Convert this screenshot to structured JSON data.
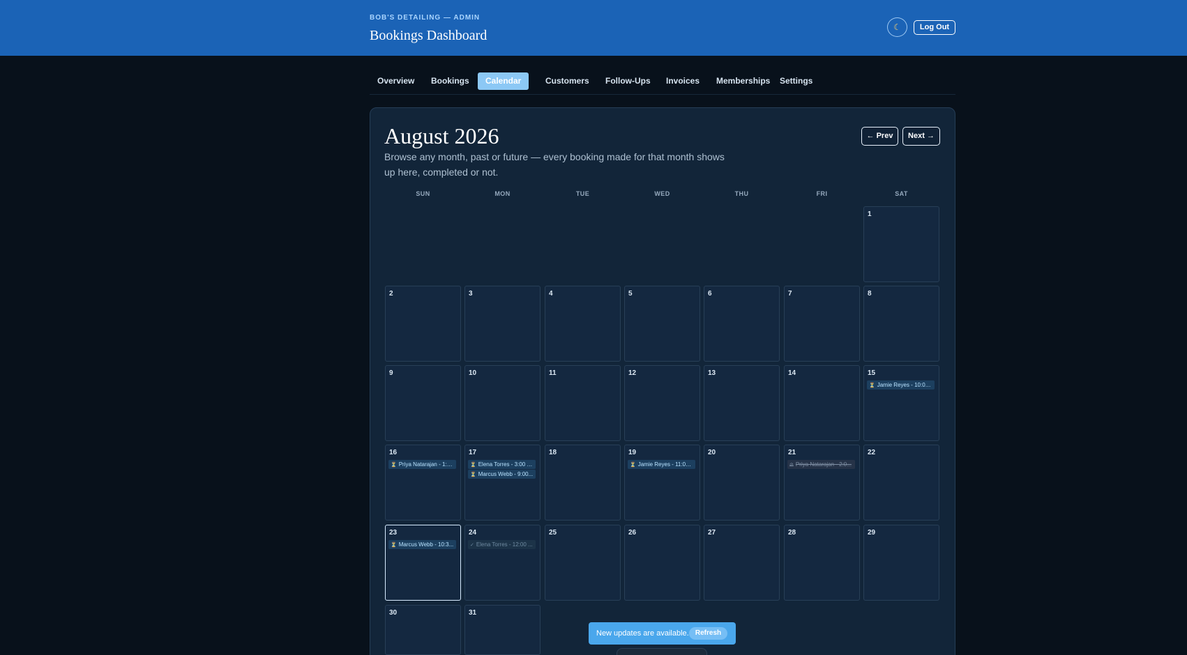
{
  "header": {
    "brand": "BOB'S DETAILING — ADMIN",
    "title": "Bookings Dashboard",
    "theme_icon": "moon-icon",
    "logout_label": "Log Out"
  },
  "tabs": [
    {
      "label": "Overview"
    },
    {
      "label": "Bookings"
    },
    {
      "label": "Calendar",
      "active": true
    },
    {
      "label": "Customers"
    },
    {
      "label": "Follow-Ups"
    },
    {
      "label": "Invoices"
    },
    {
      "label": "Memberships"
    },
    {
      "label": "Settings"
    }
  ],
  "calendar": {
    "month": "August 2026",
    "description": "Browse any month, past or future — every booking made for that month shows up here, completed or not.",
    "prev_label": "← Prev",
    "next_label": "Next →",
    "weekdays": [
      "SUN",
      "MON",
      "TUE",
      "WED",
      "THU",
      "FRI",
      "SAT"
    ],
    "days": {
      "d1": {
        "label": "1"
      },
      "d2": {
        "label": "2"
      },
      "d3": {
        "label": "3"
      },
      "d4": {
        "label": "4"
      },
      "d5": {
        "label": "5"
      },
      "d6": {
        "label": "6"
      },
      "d7": {
        "label": "7"
      },
      "d8": {
        "label": "8"
      },
      "d9": {
        "label": "9"
      },
      "d10": {
        "label": "10"
      },
      "d11": {
        "label": "11"
      },
      "d12": {
        "label": "12"
      },
      "d13": {
        "label": "13"
      },
      "d14": {
        "label": "14"
      },
      "d15": {
        "label": "15"
      },
      "d16": {
        "label": "16"
      },
      "d17": {
        "label": "17"
      },
      "d18": {
        "label": "18"
      },
      "d19": {
        "label": "19"
      },
      "d20": {
        "label": "20"
      },
      "d21": {
        "label": "21"
      },
      "d22": {
        "label": "22"
      },
      "d23": {
        "label": "23"
      },
      "d24": {
        "label": "24"
      },
      "d25": {
        "label": "25"
      },
      "d26": {
        "label": "26"
      },
      "d27": {
        "label": "27"
      },
      "d28": {
        "label": "28"
      },
      "d29": {
        "label": "29"
      },
      "d30": {
        "label": "30"
      },
      "d31": {
        "label": "31"
      }
    },
    "bookings": {
      "d15_1": {
        "text": "Jamie Reyes - 10:00 ...",
        "status_icon": "hourglass-icon"
      },
      "d16_1": {
        "text": "Priya Natarajan - 1:3...",
        "status_icon": "hourglass-icon"
      },
      "d17_1": {
        "text": "Elena Torres - 3:00 PM",
        "status_icon": "hourglass-icon"
      },
      "d17_2": {
        "text": "Marcus Webb - 9:00...",
        "status_icon": "hourglass-icon"
      },
      "d19_1": {
        "text": "Jamie Reyes - 11:00 ...",
        "status_icon": "hourglass-icon"
      },
      "d21_1": {
        "text": "Priya Natarajan - 2:0...",
        "status_icon": "cancelled-icon"
      },
      "d23_1": {
        "text": "Marcus Webb - 10:3...",
        "status_icon": "hourglass-icon"
      },
      "d24_1": {
        "text": "Elena Torres - 12:00 ...",
        "status_icon": "check-icon"
      }
    }
  },
  "toast": {
    "message": "New updates are available.",
    "refresh_label": "Refresh"
  }
}
